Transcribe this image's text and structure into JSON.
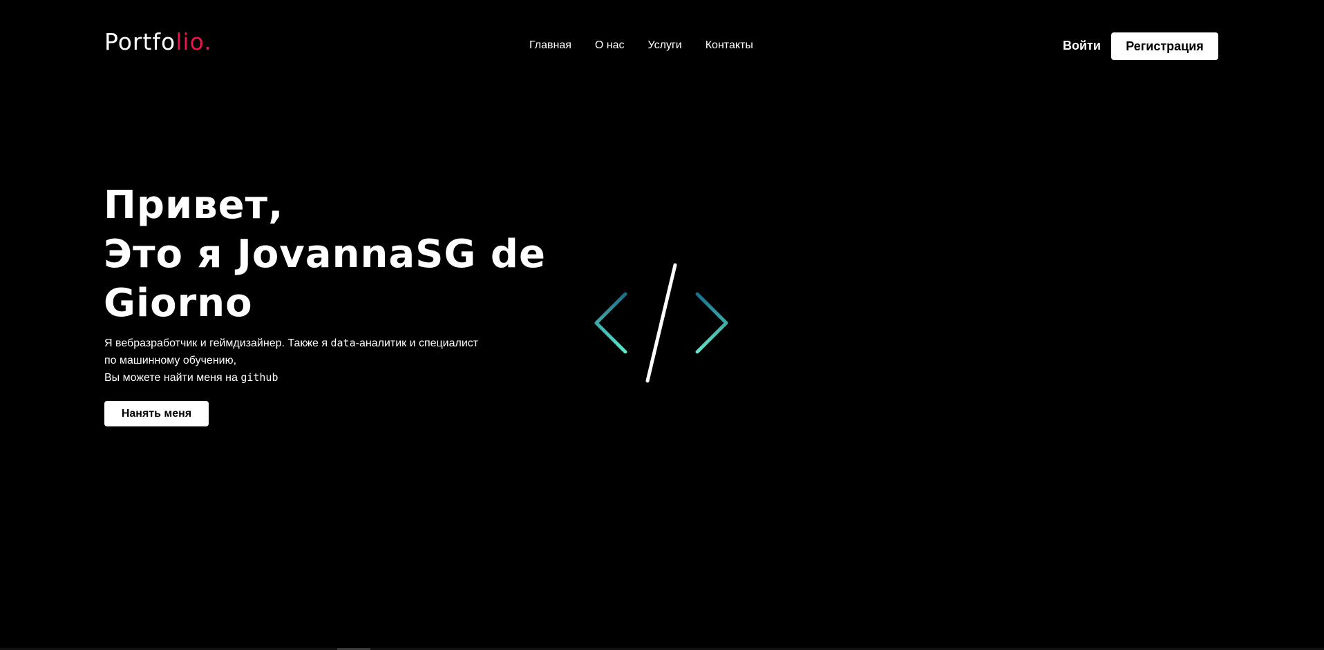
{
  "header": {
    "logo_main": "Portfo",
    "logo_accent": "lio.",
    "nav": [
      {
        "label": "Главная"
      },
      {
        "label": "О нас"
      },
      {
        "label": "Услуги"
      },
      {
        "label": "Контакты"
      }
    ],
    "login_label": "Войти",
    "register_label": "Регистрация"
  },
  "hero": {
    "title_lines": [
      "Привет,",
      "Это я JovannaSG de",
      "Giorno"
    ],
    "desc_line1_a": "Я вебразработчик и геймдизайнер. Также я ",
    "desc_line1_mono": "data",
    "desc_line1_b": "-аналитик и специалист по машинному обучению,",
    "desc_line2_a": "Вы можете найти меня на ",
    "desc_line2_mono": "github",
    "hire_label": "Нанять меня"
  },
  "colors": {
    "background": "#000000",
    "text": "#ffffff",
    "accent": "#e8164a",
    "icon_gradient_start": "#1c6e8c",
    "icon_gradient_end": "#5ee6c8"
  },
  "icons": {
    "code": "code-brackets-icon"
  }
}
